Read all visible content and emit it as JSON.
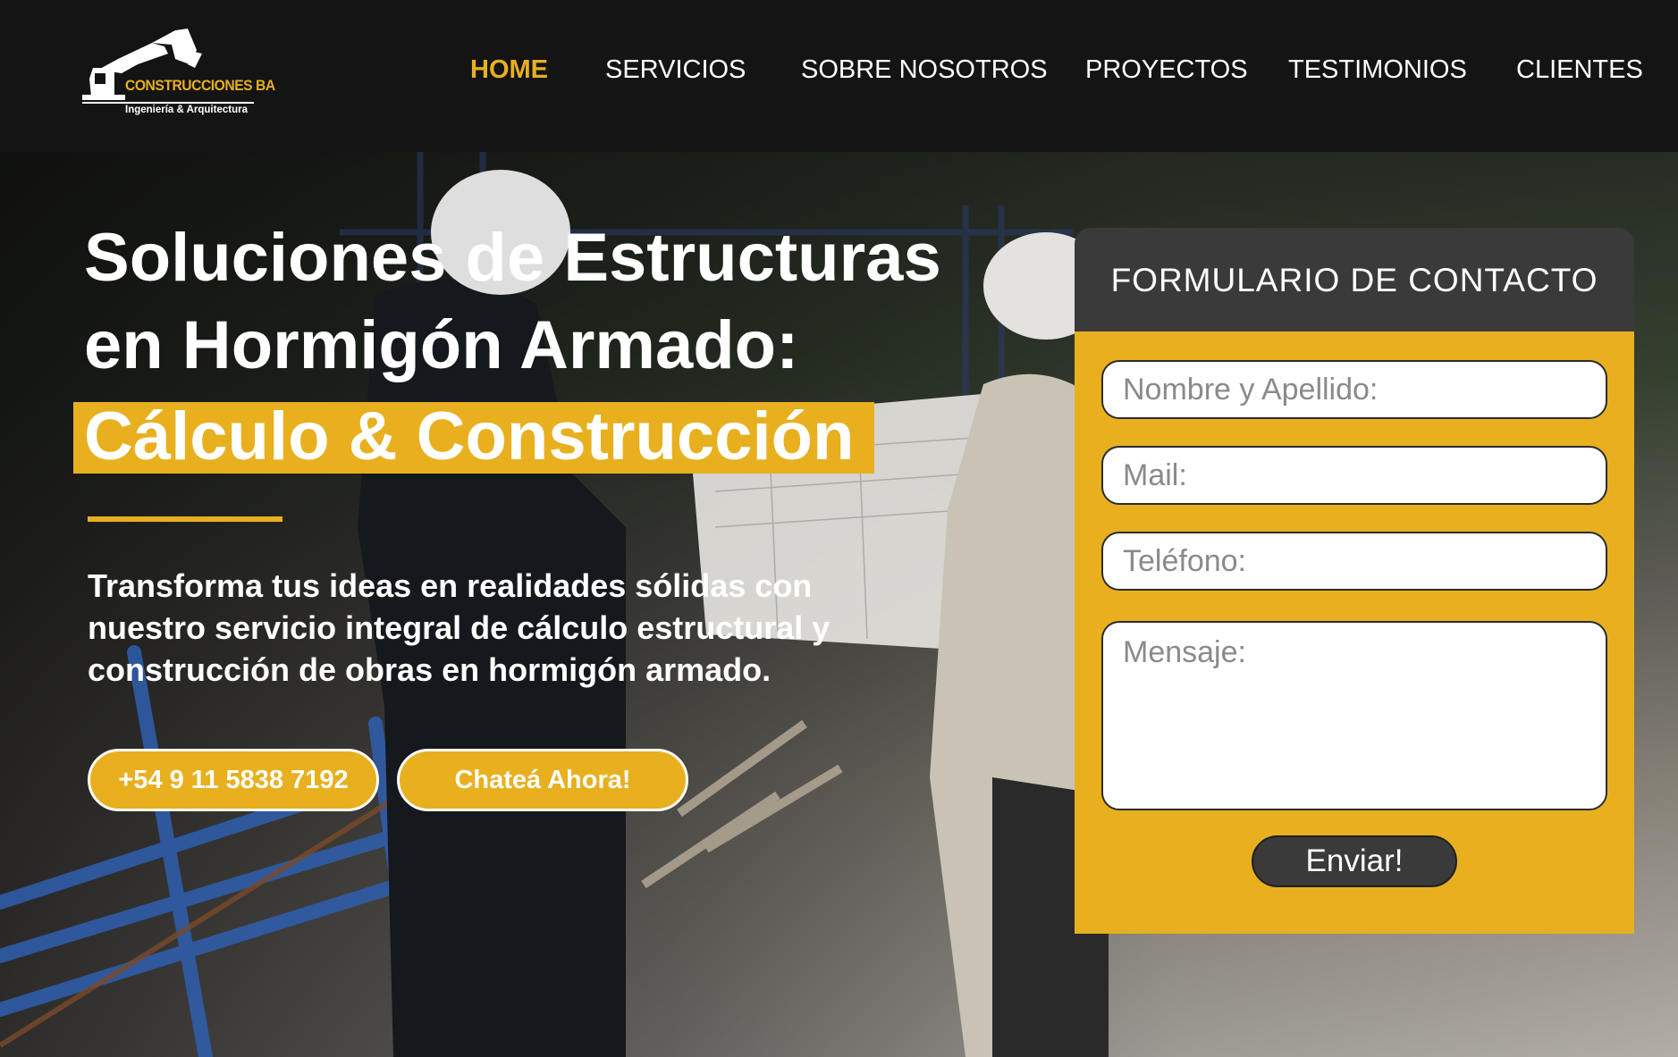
{
  "logo": {
    "name": "CONSTRUCCIONES BA",
    "tagline": "Ingeniería & Arquitectura",
    "icon": "excavator-icon"
  },
  "nav": {
    "items": [
      {
        "label": "HOME",
        "active": true
      },
      {
        "label": "SERVICIOS",
        "active": false
      },
      {
        "label": "SOBRE NOSOTROS",
        "active": false
      },
      {
        "label": "PROYECTOS",
        "active": false
      },
      {
        "label": "TESTIMONIOS",
        "active": false
      },
      {
        "label": "CLIENTES",
        "active": false
      }
    ]
  },
  "hero": {
    "headline_line1": "Soluciones de Estructuras",
    "headline_line2": "en Hormigón Armado:",
    "headline_highlight": "Cálculo & Construcción",
    "lead": "Transforma tus ideas en realidades sólidas con nuestro servicio integral de cálculo estructural y construcción de obras en hormigón armado.",
    "phone_button": "+54 9 11 5838 7192",
    "chat_button": "Chateá Ahora!"
  },
  "contact_form": {
    "title": "FORMULARIO DE CONTACTO",
    "name_placeholder": "Nombre y Apellido:",
    "mail_placeholder": "Mail:",
    "phone_placeholder": "Teléfono:",
    "message_placeholder": "Mensaje:",
    "submit_label": "Enviar!"
  },
  "colors": {
    "accent": "#e8b01f",
    "header_bg": "#141414",
    "card_head": "#3a3a3a",
    "text_light": "#ffffff"
  }
}
